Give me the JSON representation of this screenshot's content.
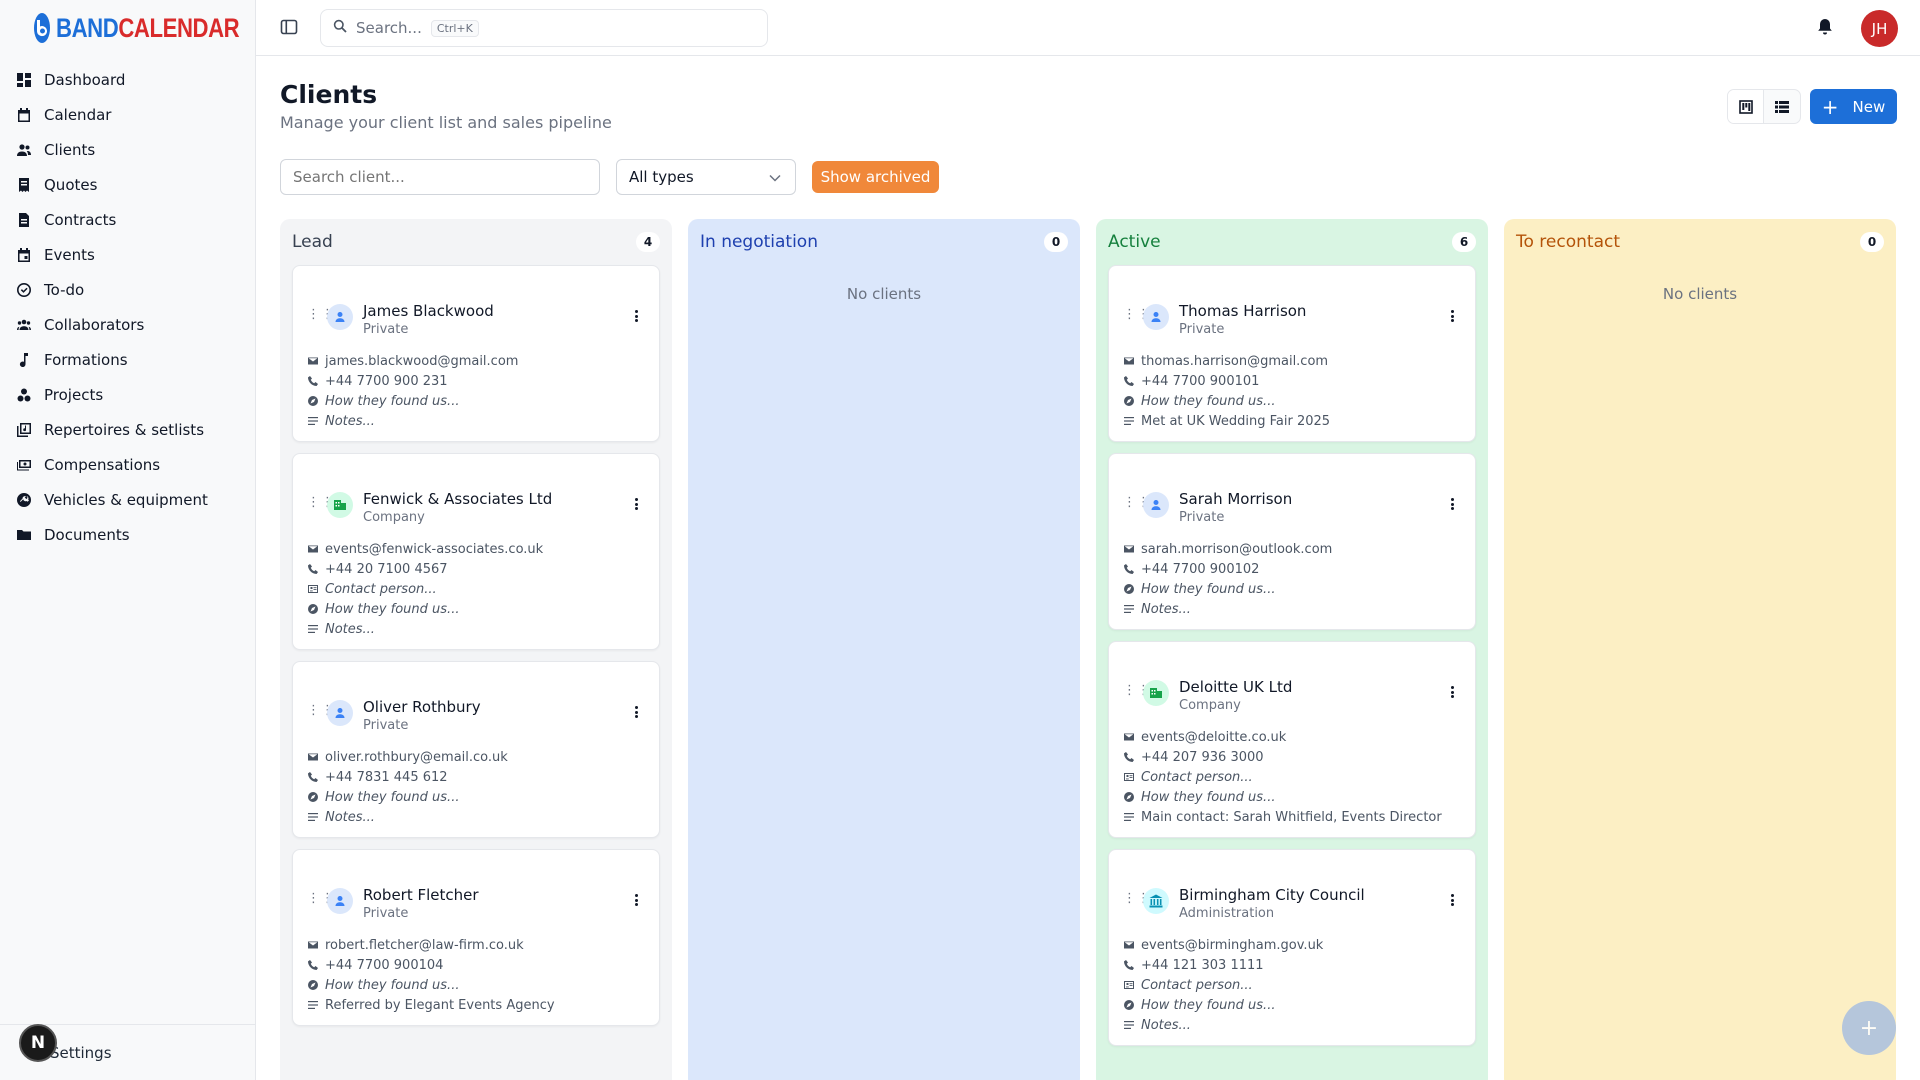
{
  "brand": {
    "part1": "BAND",
    "part2": "CALENDAR"
  },
  "sidebar": {
    "items": [
      {
        "label": "Dashboard",
        "icon": "dashboard-icon"
      },
      {
        "label": "Calendar",
        "icon": "calendar-icon"
      },
      {
        "label": "Clients",
        "icon": "users-icon"
      },
      {
        "label": "Quotes",
        "icon": "receipt-icon"
      },
      {
        "label": "Contracts",
        "icon": "document-icon"
      },
      {
        "label": "Events",
        "icon": "event-icon"
      },
      {
        "label": "To-do",
        "icon": "check-circle-icon"
      },
      {
        "label": "Collaborators",
        "icon": "group-icon"
      },
      {
        "label": "Formations",
        "icon": "music-note-icon"
      },
      {
        "label": "Projects",
        "icon": "projects-icon"
      },
      {
        "label": "Repertoires & setlists",
        "icon": "library-icon"
      },
      {
        "label": "Compensations",
        "icon": "payments-icon"
      },
      {
        "label": "Vehicles & equipment",
        "icon": "wrench-icon"
      },
      {
        "label": "Documents",
        "icon": "folder-icon"
      }
    ],
    "settings_label": "Settings",
    "n_badge": "N"
  },
  "topbar": {
    "search_placeholder": "Search...",
    "search_shortcut": "Ctrl+K",
    "avatar_initials": "JH"
  },
  "header": {
    "title": "Clients",
    "subtitle": "Manage your client list and sales pipeline",
    "new_button": "New"
  },
  "filters": {
    "search_placeholder": "Search client...",
    "type_select": "All types",
    "archived_button": "Show archived"
  },
  "columns": {
    "lead": {
      "title": "Lead",
      "count": "4",
      "cards": [
        {
          "name": "James Blackwood",
          "type": "Private",
          "email": "james.blackwood@gmail.com",
          "phone": "+44 7700 900 231",
          "source": "How they found us...",
          "notes": "Notes..."
        },
        {
          "name": "Fenwick & Associates Ltd",
          "type": "Company",
          "email": "events@fenwick-associates.co.uk",
          "phone": "+44 20 7100 4567",
          "contact": "Contact person...",
          "source": "How they found us...",
          "notes": "Notes..."
        },
        {
          "name": "Oliver Rothbury",
          "type": "Private",
          "email": "oliver.rothbury@email.co.uk",
          "phone": "+44 7831 445 612",
          "source": "How they found us...",
          "notes": "Notes..."
        },
        {
          "name": "Robert Fletcher",
          "type": "Private",
          "email": "robert.fletcher@law-firm.co.uk",
          "phone": "+44 7700 900104",
          "source": "How they found us...",
          "notes": "Referred by Elegant Events Agency"
        }
      ]
    },
    "negotiation": {
      "title": "In negotiation",
      "count": "0",
      "empty": "No clients"
    },
    "active": {
      "title": "Active",
      "count": "6",
      "cards": [
        {
          "name": "Thomas Harrison",
          "type": "Private",
          "email": "thomas.harrison@gmail.com",
          "phone": "+44 7700 900101",
          "source": "How they found us...",
          "notes": "Met at UK Wedding Fair 2025"
        },
        {
          "name": "Sarah Morrison",
          "type": "Private",
          "email": "sarah.morrison@outlook.com",
          "phone": "+44 7700 900102",
          "source": "How they found us...",
          "notes": "Notes..."
        },
        {
          "name": "Deloitte UK Ltd",
          "type": "Company",
          "email": "events@deloitte.co.uk",
          "phone": "+44 207 936 3000",
          "contact": "Contact person...",
          "source": "How they found us...",
          "notes": "Main contact: Sarah Whitfield, Events Director"
        },
        {
          "name": "Birmingham City Council",
          "type": "Administration",
          "email": "events@birmingham.gov.uk",
          "phone": "+44 121 303 1111",
          "contact": "Contact person...",
          "source": "How they found us...",
          "notes": "Notes..."
        }
      ]
    },
    "recontact": {
      "title": "To recontact",
      "count": "0",
      "empty": "No clients"
    }
  },
  "fab": "+"
}
